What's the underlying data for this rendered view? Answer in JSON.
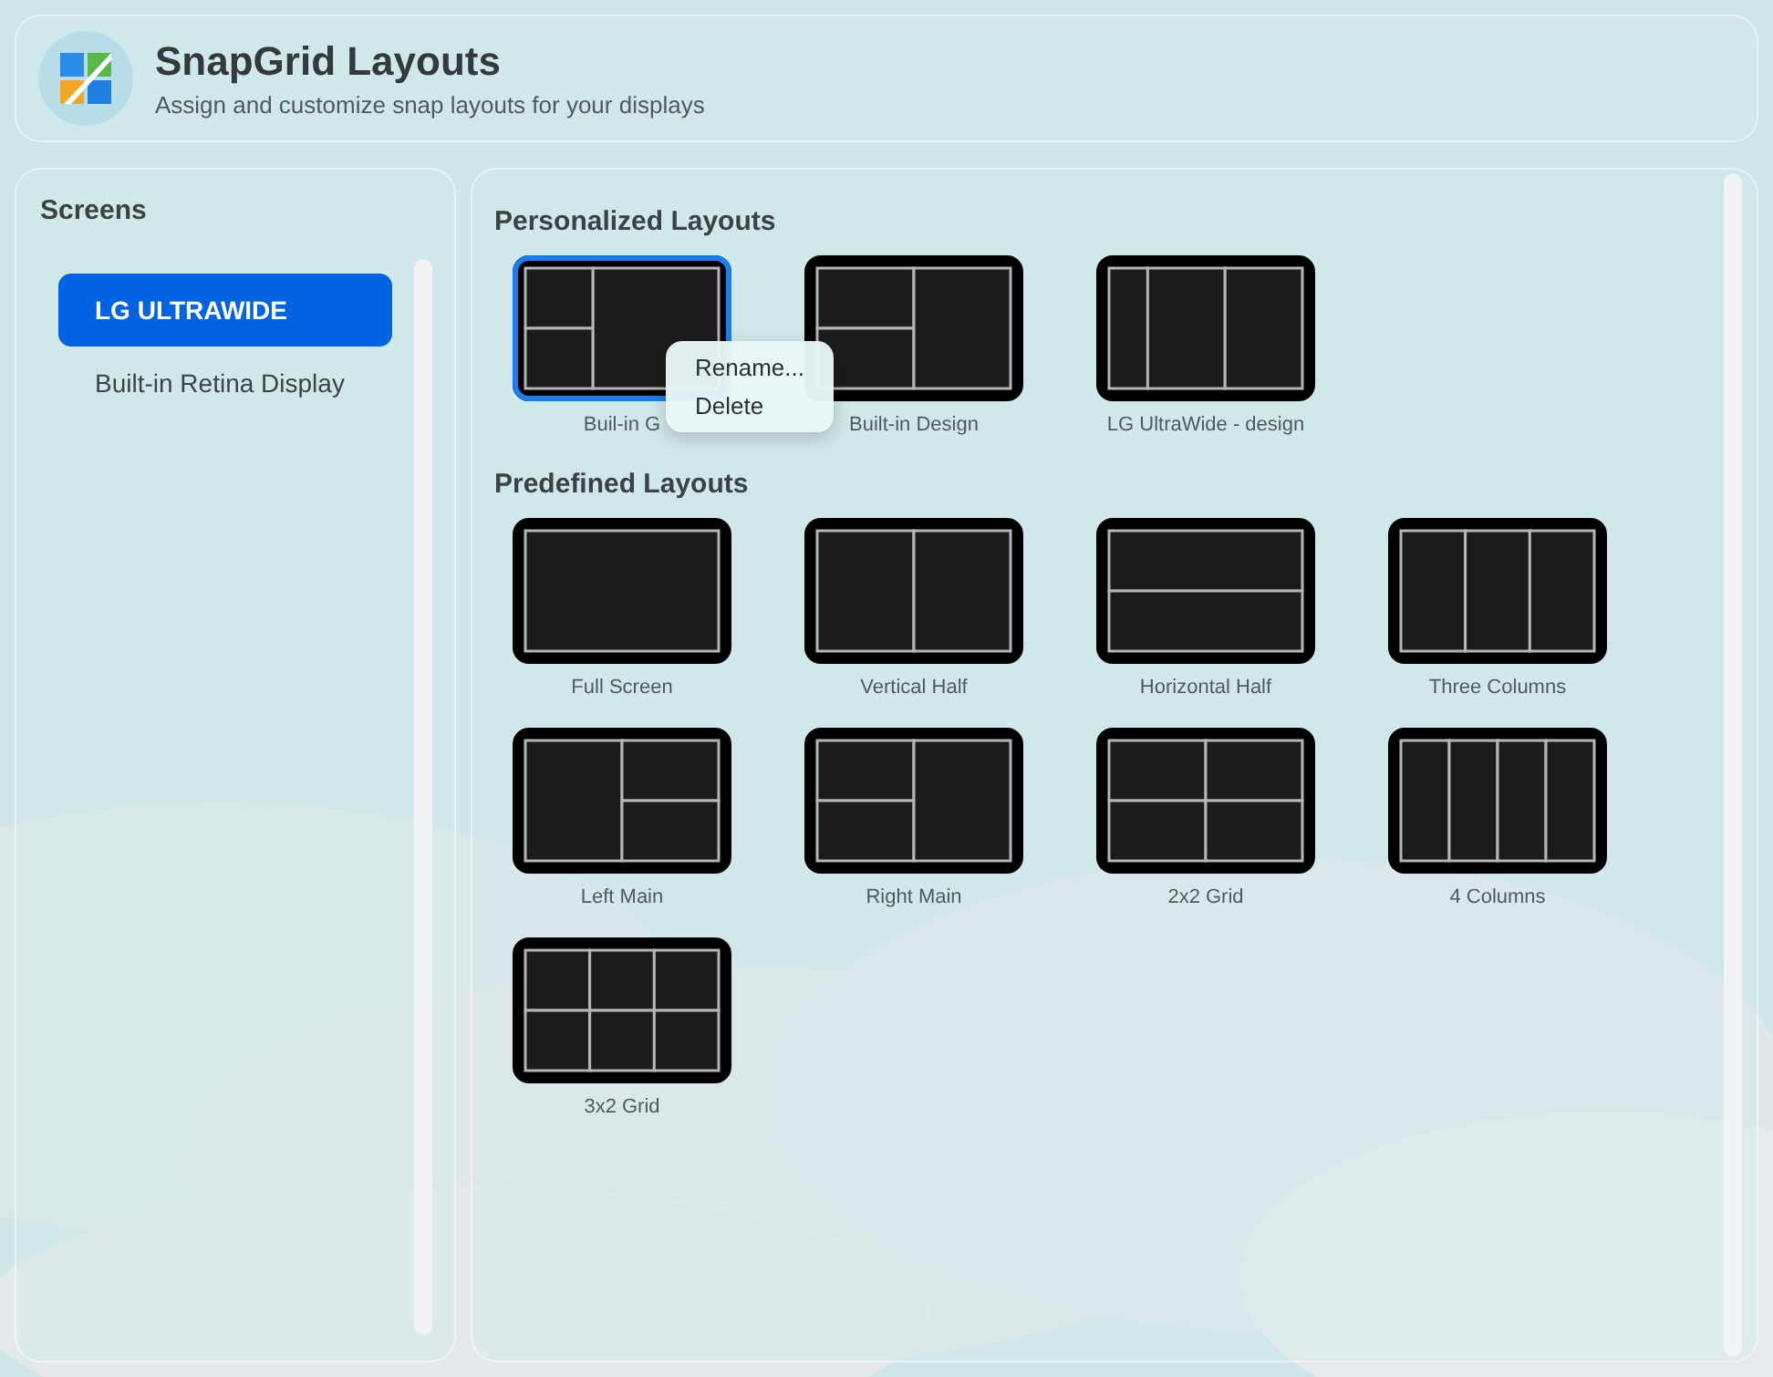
{
  "header": {
    "title": "SnapGrid Layouts",
    "subtitle": "Assign and customize snap layouts for your displays"
  },
  "sidebar": {
    "title": "Screens",
    "items": [
      {
        "label": "LG ULTRAWIDE",
        "selected": true
      },
      {
        "label": "Built-in Retina Display",
        "selected": false
      }
    ]
  },
  "sections": [
    {
      "title": "Personalized Layouts",
      "layouts": [
        {
          "label": "Buil-in G",
          "kind": "narrow-left-stack",
          "selected": true,
          "menu": [
            "Rename...",
            "Delete"
          ]
        },
        {
          "label": "Built-in Design",
          "kind": "right-main",
          "selected": false
        },
        {
          "label": "LG UltraWide - design",
          "kind": "uneven-columns",
          "selected": false
        }
      ]
    },
    {
      "title": "Predefined Layouts",
      "layouts": [
        {
          "label": "Full Screen",
          "kind": "full",
          "selected": false
        },
        {
          "label": "Vertical Half",
          "kind": "vertical-half",
          "selected": false
        },
        {
          "label": "Horizontal Half",
          "kind": "horizontal-half",
          "selected": false
        },
        {
          "label": "Three Columns",
          "kind": "three-columns",
          "selected": false
        },
        {
          "label": "Left Main",
          "kind": "left-main",
          "selected": false
        },
        {
          "label": "Right Main",
          "kind": "right-main",
          "selected": false
        },
        {
          "label": "2x2 Grid",
          "kind": "grid-2x2",
          "selected": false
        },
        {
          "label": "4 Columns",
          "kind": "four-columns",
          "selected": false
        },
        {
          "label": "3x2 Grid",
          "kind": "grid-3x2",
          "selected": false
        }
      ]
    }
  ]
}
